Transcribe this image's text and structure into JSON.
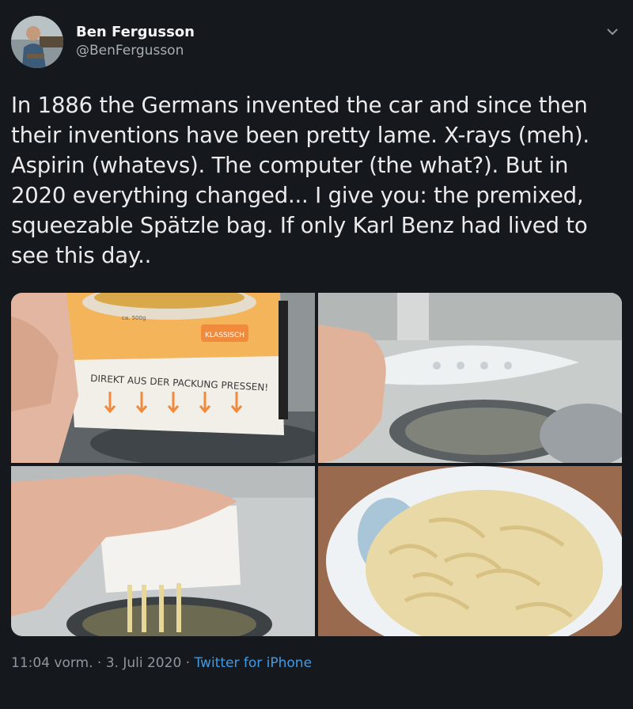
{
  "author": {
    "display_name": "Ben Fergusson",
    "handle": "@BenFergusson"
  },
  "tweet": {
    "text": "In 1886 the Germans invented the car and since then their inventions have been pretty lame. X-rays (meh). Aspirin (whatevs). The computer (the what?). But in 2020 everything changed... I give you: the premixed, squeezable Spätzle bag. If only Karl Benz had lived to see this day.."
  },
  "media": {
    "photo1": {
      "bag_label": "DIREKT AUS DER PACKUNG PRESSEN!",
      "tag": "KLASSISCH",
      "weight": "ca. 500g"
    },
    "photo2": {},
    "photo3": {},
    "photo4": {}
  },
  "meta": {
    "time": "11:04 vorm.",
    "sep1": " · ",
    "date": "3. Juli 2020",
    "sep2": " · ",
    "source": "Twitter for iPhone"
  },
  "icons": {
    "menu": "chevron-down-icon"
  },
  "colors": {
    "background": "#15181c",
    "link": "#3f9be6",
    "secondary_text": "#8f979e"
  }
}
